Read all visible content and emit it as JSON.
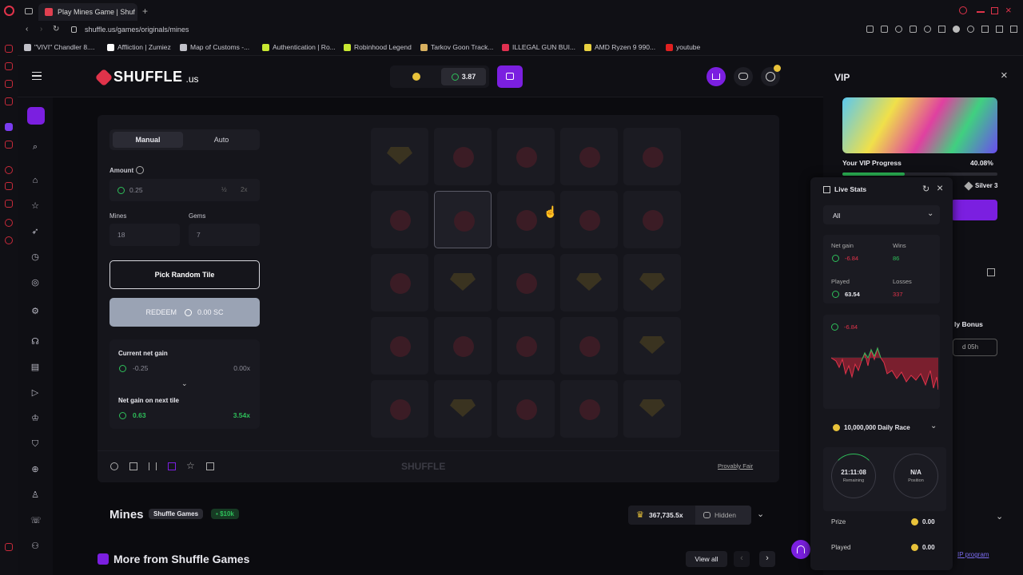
{
  "browser": {
    "tab_title": "Play Mines Game | Shuf",
    "url": "shuffle.us/games/originals/mines",
    "bookmarks": [
      {
        "label": "\"VIVI\" Chandler 8....",
        "color": "#c0c0c8"
      },
      {
        "label": "Affliction | Zumiez",
        "color": "#ffffff"
      },
      {
        "label": "Map of Customs -...",
        "color": "#c0c0c8"
      },
      {
        "label": "Authentication | Ro...",
        "color": "#c8e832"
      },
      {
        "label": "Robinhood Legend",
        "color": "#c8e832"
      },
      {
        "label": "Tarkov Goon Track...",
        "color": "#d8b060"
      },
      {
        "label": "ILLEGAL GUN BUI...",
        "color": "#e03050"
      },
      {
        "label": "AMD Ryzen 9 990...",
        "color": "#e8d040"
      },
      {
        "label": "youtube",
        "color": "#e02020"
      }
    ]
  },
  "header": {
    "logo": "SHUFFLE",
    "logo_suffix": ".us",
    "balance": "3.87"
  },
  "controls": {
    "tab_manual": "Manual",
    "tab_auto": "Auto",
    "amount_label": "Amount",
    "amount_value": "0.25",
    "half": "½",
    "double": "2x",
    "mines_label": "Mines",
    "mines_value": "18",
    "gems_label": "Gems",
    "gems_value": "7",
    "pick_random": "Pick Random Tile",
    "redeem": "REDEEM",
    "redeem_value": "0.00 SC",
    "current_net_gain_label": "Current net gain",
    "current_net_gain": "-0.25",
    "current_multiplier": "0.00x",
    "next_tile_label": "Net gain on next tile",
    "next_tile_gain": "0.63",
    "next_tile_multiplier": "3.54x"
  },
  "grid": [
    [
      "gem",
      "mine",
      "mine",
      "mine",
      "mine"
    ],
    [
      "mine",
      "mine",
      "mine",
      "mine",
      "mine"
    ],
    [
      "mine",
      "gem",
      "mine",
      "gem",
      "gem"
    ],
    [
      "mine",
      "mine",
      "mine",
      "mine",
      "gem"
    ],
    [
      "mine",
      "gem",
      "mine",
      "mine",
      "gem"
    ]
  ],
  "selected_tile": [
    1,
    1
  ],
  "game_footer": {
    "watermark": "SHUFFLE",
    "provably_fair": "Provably Fair"
  },
  "game_info": {
    "title": "Mines",
    "publisher": "Shuffle Games",
    "badge": "$10k",
    "record": "367,735.5x",
    "hidden": "Hidden"
  },
  "more_section": {
    "title": "More from Shuffle Games",
    "view_all": "View all"
  },
  "vip": {
    "title": "VIP",
    "progress_label": "Your VIP Progress",
    "progress_value": "40.08%",
    "progress_fraction": 0.4008,
    "tier": "Silver 3",
    "bonus_label": "ly Bonus",
    "bonus_time": "d 05h",
    "program_link": "IP program"
  },
  "live_stats": {
    "title": "Live Stats",
    "filter": "All",
    "net_gain_label": "Net gain",
    "net_gain": "-6.84",
    "wins_label": "Wins",
    "wins": "86",
    "played_label": "Played",
    "played": "63.54",
    "losses_label": "Losses",
    "losses": "337",
    "chart_value": "-6.84"
  },
  "race": {
    "title": "10,000,000 Daily Race",
    "remaining_time": "21:11:08",
    "remaining_label": "Remaining",
    "position": "N/A",
    "position_label": "Position",
    "prize_label": "Prize",
    "prize": "0.00",
    "played_label": "Played",
    "played": "0.00"
  },
  "colors": {
    "accent_purple": "#7b1fe0",
    "green": "#2ebf5a",
    "red": "#e0334a",
    "gold": "#e8c23a"
  }
}
